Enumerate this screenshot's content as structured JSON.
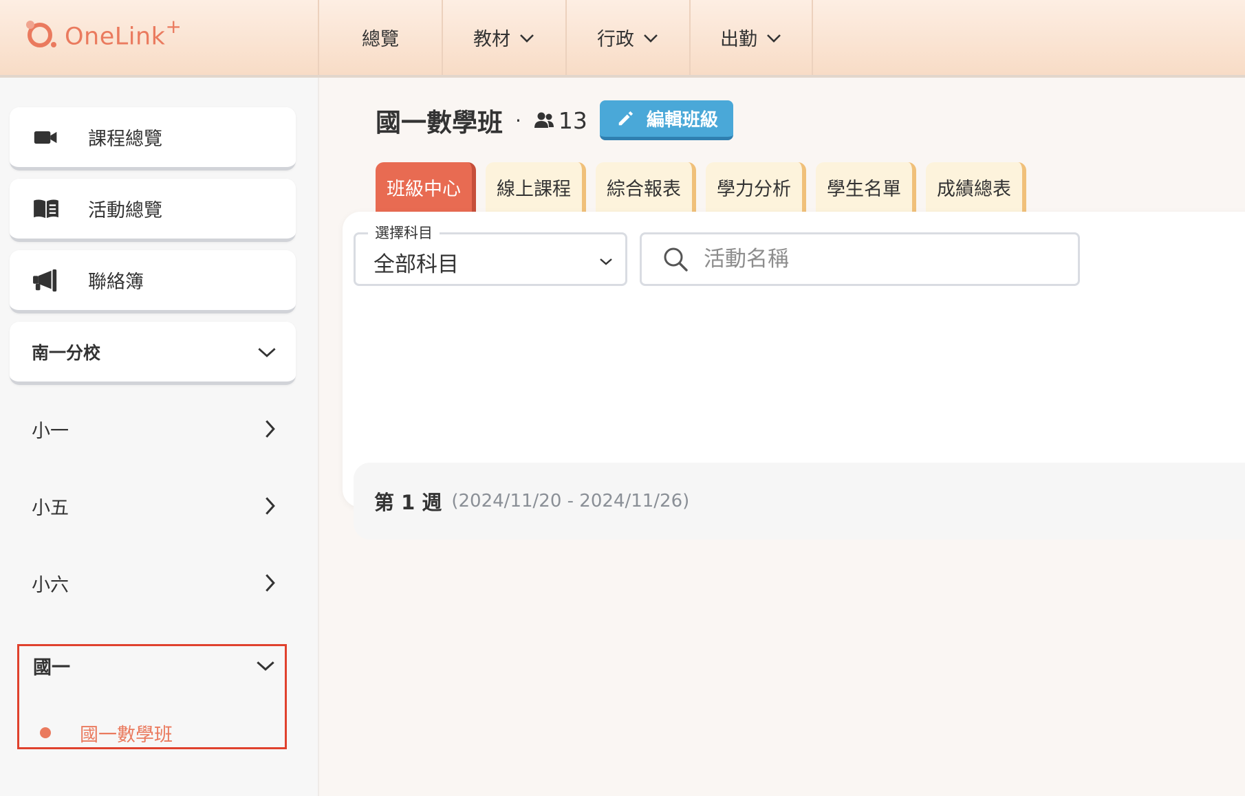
{
  "header": {
    "logo_text": "OneLink",
    "logo_sup": "+",
    "nav": [
      {
        "label": "總覽",
        "has_dropdown": false
      },
      {
        "label": "教材",
        "has_dropdown": true
      },
      {
        "label": "行政",
        "has_dropdown": true
      },
      {
        "label": "出勤",
        "has_dropdown": true
      }
    ]
  },
  "sidebar": {
    "menu": [
      {
        "label": "課程總覽",
        "icon": "video-camera-icon"
      },
      {
        "label": "活動總覽",
        "icon": "open-book-icon"
      },
      {
        "label": "聯絡簿",
        "icon": "megaphone-icon"
      }
    ],
    "branch": "南一分校",
    "grades": [
      {
        "label": "小一"
      },
      {
        "label": "小五"
      },
      {
        "label": "小六"
      }
    ],
    "open_grade": {
      "label": "國一",
      "classes": [
        "國一數學班"
      ]
    }
  },
  "main": {
    "class_title": "國一數學班",
    "separator": "·",
    "member_count": "13",
    "edit_button": "編輯班級",
    "tabs": [
      "班級中心",
      "線上課程",
      "綜合報表",
      "學力分析",
      "學生名單",
      "成績總表"
    ],
    "active_tab": "班級中心",
    "filter": {
      "legend": "選擇科目",
      "value": "全部科目"
    },
    "search": {
      "placeholder": "活動名稱",
      "value": ""
    },
    "week": {
      "label": "第 1 週",
      "range": "(2024/11/20 - 2024/11/26)"
    }
  },
  "colors": {
    "brand": "#ea7a5e",
    "active_tab": "#e86b52",
    "edit_button": "#4aa8d8",
    "highlight_border": "#e0412d"
  }
}
